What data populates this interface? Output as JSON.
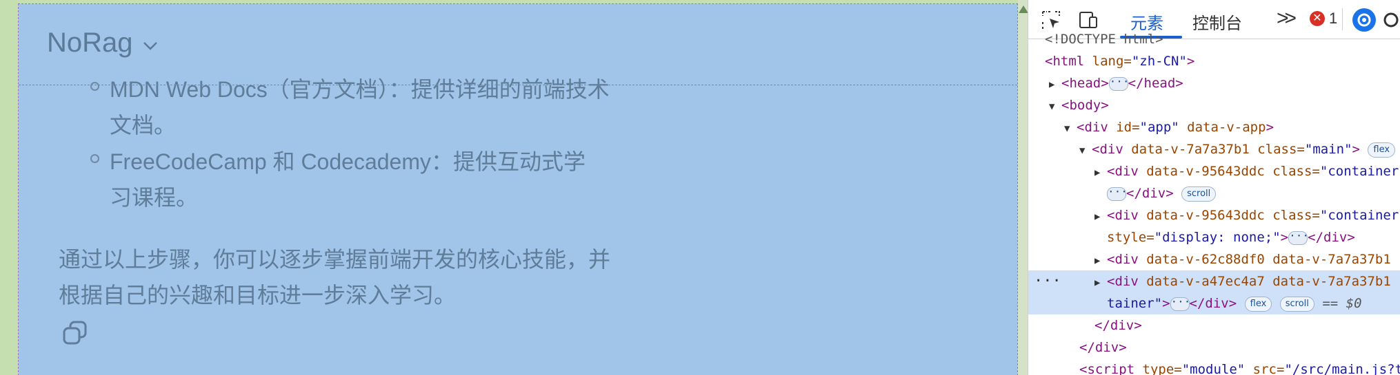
{
  "viewport": {
    "brand": "NoRag",
    "list_items": [
      {
        "line1": "MDN Web Docs（官方文档）：提供详细的前端技术",
        "line2": "文档。"
      },
      {
        "line1": "FreeCodeCamp 和 Codecademy：提供互动式学",
        "line2": "习课程。"
      }
    ],
    "paragraph": {
      "line1": "通过以上步骤，你可以逐步掌握前端开发的核心技能，并",
      "line2": "根据自己的兴趣和目标进一步深入学习。"
    },
    "copy_icon": "copy-icon"
  },
  "devtools": {
    "tabs": {
      "elements": "元素",
      "console": "控制台",
      "more": ">>"
    },
    "error_count": "1",
    "error_icon_glyph": "✕",
    "lines": {
      "l0": "<!DOCTYPE html>",
      "l1_tag": "<html",
      "l1_attr": " lang=",
      "l1_val": "\"zh-CN\"",
      "l1_end": ">",
      "l2_open": "<head>",
      "l2_close": "</head>",
      "l3": "<body>",
      "l4_tag": "<div",
      "l4_attr": " id=",
      "l4_val": "\"app\"",
      "l4_attr2": " data-v-app",
      "l4_end": ">",
      "l5_tag": "<div",
      "l5_attr": " data-v-7a7a37b1 class=",
      "l5_val": "\"main\"",
      "l5_end": ">",
      "l5_pill": "flex",
      "l6_tag": "<div",
      "l6_attr": " data-v-95643ddc class=",
      "l6_val": "\"container",
      "l7_close": "</div>",
      "l7_pill": "scroll",
      "l8_tag": "<div",
      "l8_attr": " data-v-95643ddc class=",
      "l8_val": "\"container",
      "l9_attr": "style=",
      "l9_val": "\"display: none;\"",
      "l9_mid": ">",
      "l9_close": "</div>",
      "l10_tag": "<div",
      "l10_attr": " data-v-62c88df0 data-v-7a7a37b1",
      "l11_tag": "<div",
      "l11_attr": " data-v-a47ec4a7 data-v-7a7a37b1",
      "l12_val": "tainer\"",
      "l12_mid": ">",
      "l12_close": "</div>",
      "l12_pill1": "flex",
      "l12_pill2": "scroll",
      "l12_ref": "== $0",
      "l13": "</div>",
      "l14": "</div>",
      "l15_tag": "<script",
      "l15_attr": " type=",
      "l15_val": "\"module\"",
      "l15_attr2": " src=",
      "l15_val2": "\"/src/main.js?t"
    },
    "gutter": "···"
  },
  "colors": {
    "highlight": "#a0c5e8",
    "margin_green": "#c6dfb0",
    "accent_blue": "#1a5fcb",
    "error_red": "#d93025"
  }
}
